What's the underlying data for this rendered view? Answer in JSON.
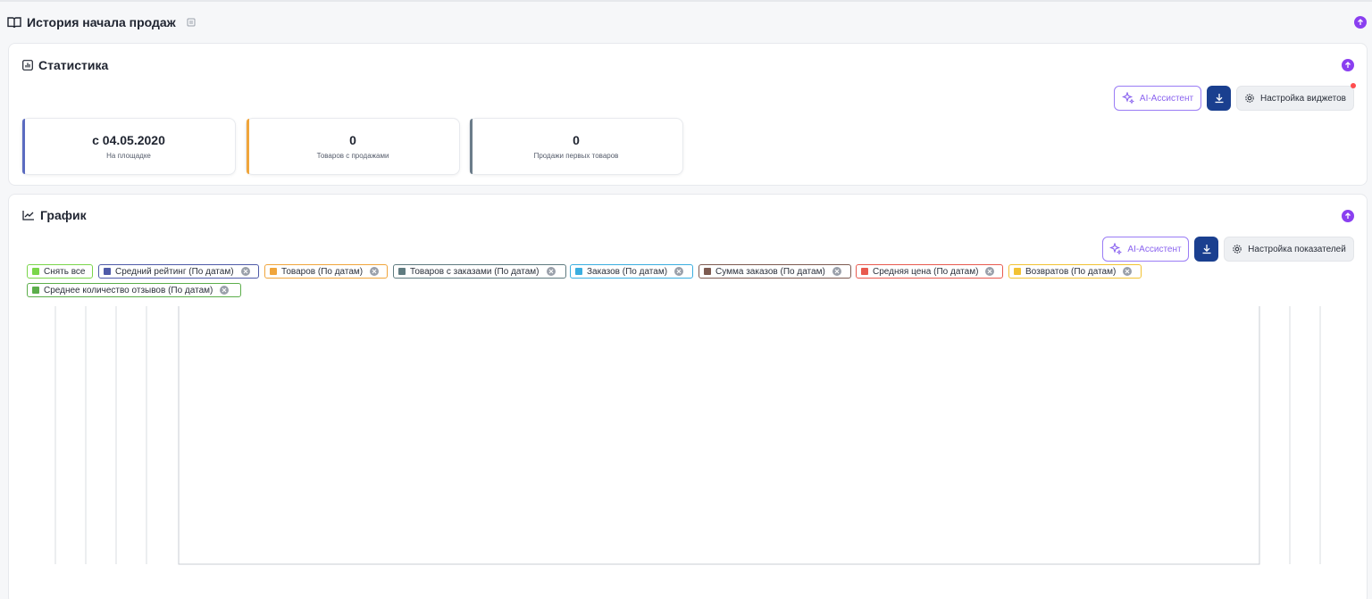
{
  "page": {
    "title": "История начала продаж",
    "accent": "#8a3ff0"
  },
  "stats_section": {
    "title": "Статистика",
    "ai_label": "AI-Ассистент",
    "settings_label": "Настройка виджетов",
    "cards": [
      {
        "value": "с 04.05.2020",
        "label": "На площадке",
        "color": "#5b6bc0"
      },
      {
        "value": "0",
        "label": "Товаров с продажами",
        "color": "#f0a53b"
      },
      {
        "value": "0",
        "label": "Продажи первых товаров",
        "color": "#6b7c8a"
      }
    ]
  },
  "chart_section": {
    "title": "График",
    "ai_label": "AI-Ассистент",
    "settings_label": "Настройка показателей",
    "legend": [
      {
        "label": "Снять все",
        "color": "#7ad64a",
        "removable": false
      },
      {
        "label": "Средний рейтинг (По датам)",
        "color": "#4e5aa8",
        "removable": true
      },
      {
        "label": "Товаров (По датам)",
        "color": "#f0a53b",
        "removable": true
      },
      {
        "label": "Товаров с заказами (По датам)",
        "color": "#5f7b80",
        "removable": true
      },
      {
        "label": "Заказов (По датам)",
        "color": "#3aaee0",
        "removable": true
      },
      {
        "label": "Сумма заказов (По датам)",
        "color": "#7d5a50",
        "removable": true
      },
      {
        "label": "Средняя цена (По датам)",
        "color": "#e85a4f",
        "removable": true
      },
      {
        "label": "Возвратов (По датам)",
        "color": "#f2c233",
        "removable": true
      },
      {
        "label": "Среднее количество отзывов (По датам)",
        "color": "#5cae4b",
        "removable": true
      }
    ]
  },
  "chart_data": {
    "type": "line",
    "series": [],
    "x": [],
    "xlabel": "",
    "ylabel": ""
  }
}
